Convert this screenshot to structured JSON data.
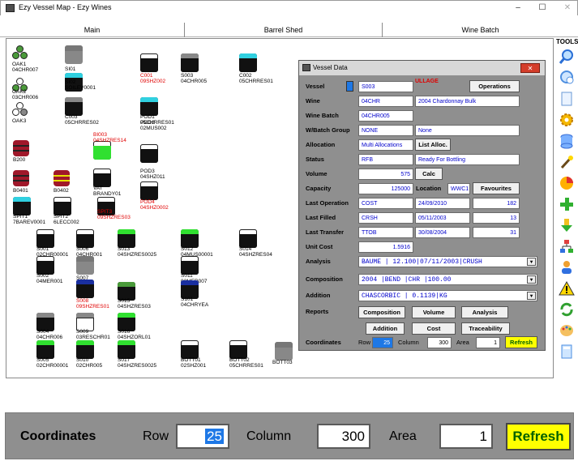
{
  "window": {
    "title": "Ezy Vessel Map - Ezy Wines",
    "minimize": "–",
    "maximize": "☐",
    "close": "✕"
  },
  "tabs": [
    "Main",
    "Barrel Shed",
    "Wine Batch"
  ],
  "tools_label": "TOOLS",
  "vessels": [
    {
      "name": "OAK1",
      "sub": "04CHR007"
    },
    {
      "name": "OAK2",
      "sub": "03CHR006"
    },
    {
      "name": "OAK3",
      "sub": ""
    },
    {
      "name": "SI01",
      "sub": ""
    },
    {
      "name": "SI02",
      "sub": "SOILEV0001"
    },
    {
      "name": "C001",
      "sub": "09SHZ002"
    },
    {
      "name": "S003",
      "sub": "04CHR005"
    },
    {
      "name": "C002",
      "sub": "05CHRRES01"
    },
    {
      "name": "C003",
      "sub": "05CHRRES02"
    },
    {
      "name": "POD1",
      "sub": "05CHRRES01"
    },
    {
      "name": "POD2",
      "sub": "02MUS002"
    },
    {
      "name": "B200",
      "sub": ""
    },
    {
      "name": "BI003",
      "sub": "04SHZRES14"
    },
    {
      "name": "POD3",
      "sub": "04SHZ011"
    },
    {
      "name": "B0401",
      "sub": ""
    },
    {
      "name": "B0402",
      "sub": ""
    },
    {
      "name": "VAT",
      "sub": "BRANDY01"
    },
    {
      "name": "POD4",
      "sub": "04SHZ0002"
    },
    {
      "name": "SPIT1",
      "sub": "7BAREV0001"
    },
    {
      "name": "SPIT2",
      "sub": "6LECC002"
    },
    {
      "name": "SPIT3",
      "sub": "09SHZRES03"
    },
    {
      "name": "S001",
      "sub": "02CHR00001"
    },
    {
      "name": "S006",
      "sub": "04CHR001"
    },
    {
      "name": "S013",
      "sub": "04SHZRES0025"
    },
    {
      "name": "S012",
      "sub": "04MUS00001"
    },
    {
      "name": "S014",
      "sub": "04SHZRES04"
    },
    {
      "name": "S002",
      "sub": "04MER001"
    },
    {
      "name": "S007",
      "sub": ""
    },
    {
      "name": "S011",
      "sub": "02MER007"
    },
    {
      "name": "S008",
      "sub": "09SHZRES01"
    },
    {
      "name": "S015",
      "sub": "04SHZRES03"
    },
    {
      "name": "S101",
      "sub": "04CHRYEA"
    },
    {
      "name": "S004",
      "sub": "04CHR006"
    },
    {
      "name": "S009",
      "sub": "03RESCHR01"
    },
    {
      "name": "S016",
      "sub": "04SHZORL01"
    },
    {
      "name": "S005",
      "sub": "02CHR00001"
    },
    {
      "name": "S010",
      "sub": "02CHR005"
    },
    {
      "name": "S017",
      "sub": "04SHZRES0025"
    },
    {
      "name": "BOTT01",
      "sub": "02SHZ001"
    },
    {
      "name": "BOTT02",
      "sub": "05CHRRES01"
    },
    {
      "name": "BOTT03",
      "sub": ""
    }
  ],
  "dialog": {
    "title": "Vessel Data",
    "close": "✕",
    "labels": {
      "vessel": "Vessel",
      "wine": "Wine",
      "batch": "Wine Batch",
      "group": "W/Batch Group",
      "allocation": "Allocation",
      "status": "Status",
      "volume": "Volume",
      "capacity": "Capacity",
      "last_op": "Last Operation",
      "last_filled": "Last Filled",
      "last_transfer": "Last Transfer",
      "unit_cost": "Unit Cost",
      "analysis": "Analysis",
      "composition": "Composition",
      "addition": "Addition",
      "reports": "Reports",
      "coordinates": "Coordinates",
      "location": "Location",
      "row": "Row",
      "column": "Column",
      "area": "Area"
    },
    "ullage": "ULLAGE",
    "vessel": "S003",
    "wine_code": "04CHR",
    "wine_desc": "2004 Chardonnay Bulk",
    "batch": "04CHR005",
    "group_code": "NONE",
    "group_desc": "None",
    "allocation": "Multi Allocations",
    "status_code": "RFB",
    "status_desc": "Ready For Bottling",
    "volume": "575",
    "capacity": "125000",
    "location": "WWC1",
    "last_op": {
      "code": "COST",
      "date": "24/09/2010",
      "num": "182"
    },
    "last_filled": {
      "code": "CRSH",
      "date": "05/11/2003",
      "num": "13"
    },
    "last_transfer": {
      "code": "TTOB",
      "date": "30/08/2004",
      "num": "31"
    },
    "unit_cost": "1.5916",
    "analysis": "BAUME    |  12.100|07/11/2003|CRUSH",
    "composition": "2004     |BEND    |CHR         |100.00",
    "addition": "CHASCORBIC       |          0.1139|KG",
    "buttons": {
      "operations": "Operations",
      "list_alloc": "List Alloc.",
      "calc": "Calc",
      "favourites": "Favourites",
      "composition": "Composition",
      "volume": "Volume",
      "analysis": "Analysis",
      "addition": "Addition",
      "cost": "Cost",
      "traceability": "Traceability",
      "refresh": "Refresh"
    },
    "row": "25",
    "column": "300",
    "area": "1"
  },
  "zoom": {
    "coordinates": "Coordinates",
    "row_label": "Row",
    "row": "25",
    "column_label": "Column",
    "column": "300",
    "area_label": "Area",
    "area": "1",
    "refresh": "Refresh"
  },
  "colors": {
    "wine_red": "#ff2020",
    "green": "#30e030",
    "cyan": "#30d0e0",
    "blue": "#1a2fa0",
    "dialog": "#8f8f8f",
    "refresh": "#ffff00"
  }
}
